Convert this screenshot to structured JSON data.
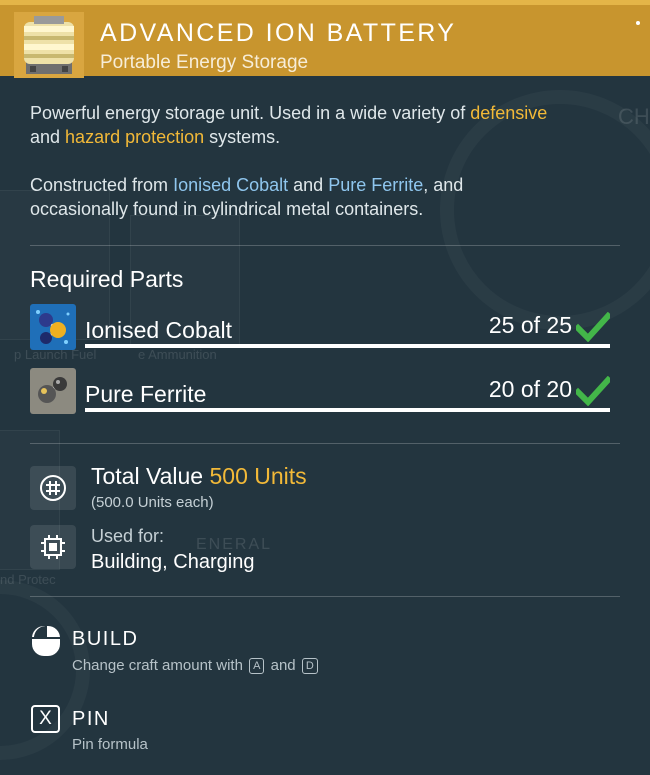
{
  "item": {
    "title": "ADVANCED ION BATTERY",
    "subtitle": "Portable Energy Storage",
    "icon": "battery-icon"
  },
  "description": {
    "p1_part1": "Powerful energy storage unit. Used in a wide variety of ",
    "p1_hl1": "defensive",
    "p1_part2": "and ",
    "p1_hl2": "hazard protection",
    "p1_part3": " systems.",
    "p2_part1": "Constructed from ",
    "p2_hl1": "Ionised Cobalt",
    "p2_part2": " and ",
    "p2_hl2": "Pure Ferrite",
    "p2_part3": ", and",
    "p2_line2": "occasionally found in cylindrical metal containers."
  },
  "required_parts": {
    "title": "Required Parts",
    "items": [
      {
        "name": "Ionised Cobalt",
        "count": "25 of 25",
        "icon": "ionised-cobalt-icon",
        "complete": true
      },
      {
        "name": "Pure Ferrite",
        "count": "20 of 20",
        "icon": "pure-ferrite-icon",
        "complete": true
      }
    ]
  },
  "value": {
    "label": "Total Value ",
    "amount": "500 Units",
    "each": "(500.0 Units each)",
    "icon": "units-currency-icon"
  },
  "used_for": {
    "label": "Used for:",
    "value": "Building, Charging",
    "icon": "chip-icon"
  },
  "actions": {
    "build_label": "BUILD",
    "build_sub_part1": "Change craft amount with",
    "key_a": "A",
    "build_sub_and": "and",
    "key_d": "D",
    "pin_key": "X",
    "pin_label": "PIN",
    "pin_sub": "Pin formula"
  },
  "background_text": {
    "t1": "p Launch Fuel",
    "t2": "e Ammunition",
    "t3": "nd Protec",
    "t4": "ENERAL",
    "t5": "CH"
  },
  "colors": {
    "header": "#c8952e",
    "panel": "#23353f",
    "highlight_gold": "#f2b938",
    "highlight_blue": "#8fc6ee",
    "check_green": "#43b649"
  }
}
